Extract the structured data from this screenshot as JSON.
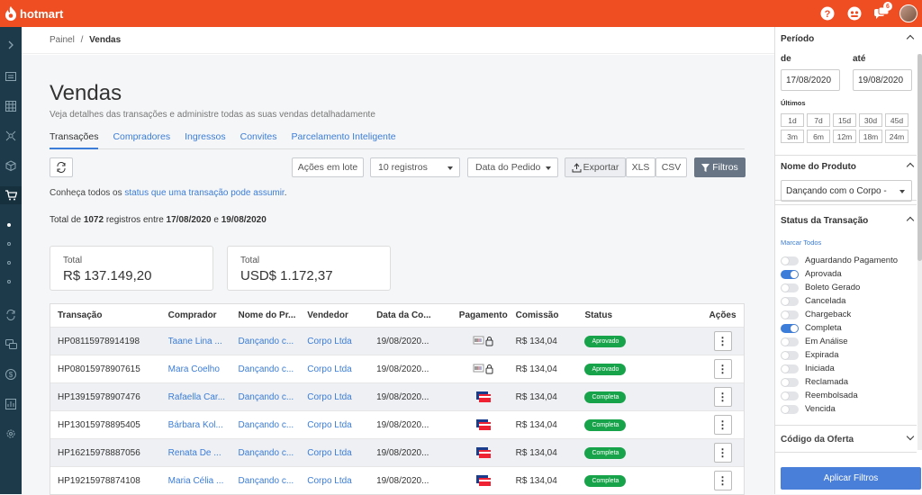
{
  "app": {
    "brand": "hotmart",
    "notif_count": "6"
  },
  "breadcrumb": {
    "parent": "Painel",
    "separator": "/",
    "current": "Vendas"
  },
  "page": {
    "title": "Vendas",
    "subtitle": "Veja detalhes das transações e administre todas as suas vendas detalhadamente"
  },
  "tabs": [
    {
      "label": "Transações",
      "active": true
    },
    {
      "label": "Compradores"
    },
    {
      "label": "Ingressos"
    },
    {
      "label": "Convites"
    },
    {
      "label": "Parcelamento Inteligente"
    }
  ],
  "toolbar": {
    "bulk_label": "Ações em lote",
    "per_page": "10 registros",
    "sort_by": "Data do Pedido",
    "export_label": "Exportar",
    "xls_label": "XLS",
    "csv_label": "CSV",
    "filters_label": "Filtros"
  },
  "info": {
    "prefix": "Conheça todos os ",
    "link": "status que uma transação pode assumir",
    "suffix": "."
  },
  "summary": {
    "prefix": "Total de ",
    "count": "1072",
    "mid": " registros entre ",
    "start": "17/08/2020",
    "and": " e ",
    "end": "19/08/2020"
  },
  "cards": [
    {
      "label": "Total",
      "value": "R$ 137.149,20"
    },
    {
      "label": "Total",
      "value": "USD$ 1.172,37"
    }
  ],
  "table": {
    "headers": [
      "Transação",
      "Comprador",
      "Nome do Pr...",
      "Vendedor",
      "Data da Co...",
      "Pagamento",
      "Comissão",
      "Status",
      "Ações"
    ],
    "rows": [
      {
        "id": "HP08115978914198",
        "buyer": "Taane Lina ...",
        "product": "Dançando c...",
        "seller": "Corpo Ltda",
        "date": "19/08/2020...",
        "payment": "boleto-icon",
        "commission": "R$ 134,04",
        "status": "Aprovado"
      },
      {
        "id": "HP08015978907615",
        "buyer": "Mara Coelho",
        "product": "Dançando c...",
        "seller": "Corpo Ltda",
        "date": "19/08/2020...",
        "payment": "boleto-icon",
        "commission": "R$ 134,04",
        "status": "Aprovado"
      },
      {
        "id": "HP13915978907476",
        "buyer": "Rafaella Car...",
        "product": "Dançando c...",
        "seller": "Corpo Ltda",
        "date": "19/08/2020...",
        "payment": "card-icon",
        "commission": "R$ 134,04",
        "status": "Completa"
      },
      {
        "id": "HP13015978895405",
        "buyer": "Bárbara Kol...",
        "product": "Dançando c...",
        "seller": "Corpo Ltda",
        "date": "19/08/2020...",
        "payment": "card-icon",
        "commission": "R$ 134,04",
        "status": "Completa"
      },
      {
        "id": "HP16215978887056",
        "buyer": "Renata De ...",
        "product": "Dançando c...",
        "seller": "Corpo Ltda",
        "date": "19/08/2020...",
        "payment": "card-icon",
        "commission": "R$ 134,04",
        "status": "Completa"
      },
      {
        "id": "HP19215978874108",
        "buyer": "Maria Célia ...",
        "product": "Dançando c...",
        "seller": "Corpo Ltda",
        "date": "19/08/2020...",
        "payment": "card-icon",
        "commission": "R$ 134,04",
        "status": "Completa"
      }
    ]
  },
  "filters": {
    "period": {
      "title": "Período",
      "from_label": "de",
      "to_label": "até",
      "from_value": "17/08/2020",
      "to_value": "19/08/2020",
      "last_label": "Últimos",
      "presets": [
        "1d",
        "7d",
        "15d",
        "30d",
        "45d",
        "3m",
        "6m",
        "12m",
        "18m",
        "24m"
      ]
    },
    "product": {
      "title": "Nome do Produto",
      "value": "Dançando com o Corpo - "
    },
    "status": {
      "title": "Status da Transação",
      "mark_all": "Marcar Todos",
      "items": [
        {
          "label": "Aguardando Pagamento",
          "on": false
        },
        {
          "label": "Aprovada",
          "on": true
        },
        {
          "label": "Boleto Gerado",
          "on": false
        },
        {
          "label": "Cancelada",
          "on": false
        },
        {
          "label": "Chargeback",
          "on": false
        },
        {
          "label": "Completa",
          "on": true
        },
        {
          "label": "Em Análise",
          "on": false
        },
        {
          "label": "Expirada",
          "on": false
        },
        {
          "label": "Iniciada",
          "on": false
        },
        {
          "label": "Reclamada",
          "on": false
        },
        {
          "label": "Reembolsada",
          "on": false
        },
        {
          "label": "Vencida",
          "on": false
        }
      ]
    },
    "offer": {
      "title": "Código da Oferta"
    },
    "apply_label": "Aplicar Filtros"
  },
  "colors": {
    "brand": "#ef4e23",
    "sidebar": "#1d3a4a",
    "link": "#3b7dd8",
    "status_green": "#17a34a",
    "apply": "#4a7fd9"
  }
}
